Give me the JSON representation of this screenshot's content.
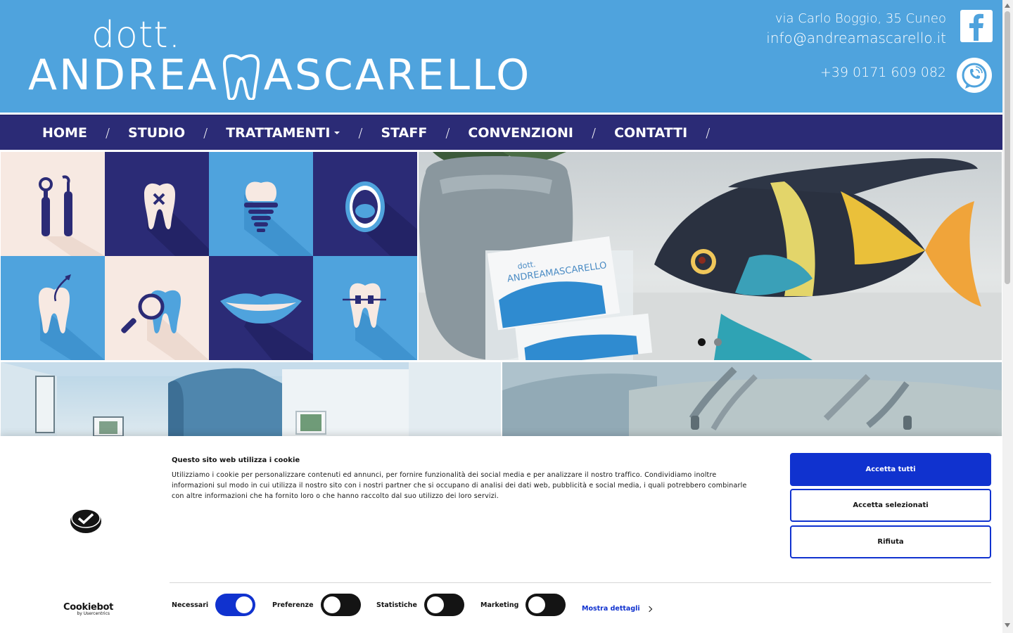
{
  "header": {
    "logo_dott": "dott.",
    "logo_name_left": "ANDREA",
    "logo_name_right": "ASCARELLO",
    "address": "via Carlo Boggio, 35 Cuneo",
    "email": "info@andreamascarello.it",
    "phone": "+39 0171 609 082",
    "facebook_icon": "facebook-icon",
    "phone_icon": "phone-icon"
  },
  "nav": {
    "items": [
      {
        "label": "HOME",
        "dropdown": false
      },
      {
        "label": "STUDIO",
        "dropdown": false
      },
      {
        "label": "TRATTAMENTI",
        "dropdown": true
      },
      {
        "label": "STAFF",
        "dropdown": false
      },
      {
        "label": "CONVENZIONI",
        "dropdown": false
      },
      {
        "label": "CONTATTI",
        "dropdown": false
      }
    ],
    "separator": "/"
  },
  "tiles": [
    {
      "icon": "dental-tools-icon",
      "bg": "#f7e9e2"
    },
    {
      "icon": "tooth-extraction-icon",
      "bg": "#2b2b76"
    },
    {
      "icon": "dental-implant-icon",
      "bg": "#4fa3dd"
    },
    {
      "icon": "open-mouth-icon",
      "bg": "#2b2b76"
    },
    {
      "icon": "root-canal-icon",
      "bg": "#4fa3dd"
    },
    {
      "icon": "tooth-magnifier-icon",
      "bg": "#f7e9e2"
    },
    {
      "icon": "lips-icon",
      "bg": "#2b2b76"
    },
    {
      "icon": "tooth-braces-icon",
      "bg": "#4fa3dd"
    }
  ],
  "slider": {
    "card_text_dott": "dott.",
    "card_text_name": "ANDREAMASCARELLO",
    "active_slide": 1,
    "slide_count": 2
  },
  "cookie": {
    "title": "Questo sito web utilizza i cookie",
    "text": "Utilizziamo i cookie per personalizzare contenuti ed annunci, per fornire funzionalità dei social media e per analizzare il nostro traffico. Condividiamo inoltre informazioni sul modo in cui utilizza il nostro sito con i nostri partner che si occupano di analisi dei dati web, pubblicità e social media, i quali potrebbero combinarle con altre informazioni che ha fornito loro o che hanno raccolto dal suo utilizzo dei loro servizi.",
    "accept_all": "Accetta tutti",
    "accept_selected": "Accetta selezionati",
    "reject": "Rifiuta",
    "brand": "Cookiebot",
    "brand_by": "by Usercentrics",
    "toggles": [
      {
        "label": "Necessari",
        "on": true
      },
      {
        "label": "Preferenze",
        "on": false
      },
      {
        "label": "Statistiche",
        "on": false
      },
      {
        "label": "Marketing",
        "on": false
      }
    ],
    "details_link": "Mostra dettagli",
    "colors": {
      "accent": "#1032cf",
      "dark": "#141414"
    }
  },
  "colors": {
    "header_bg": "#4fa3dd",
    "nav_bg": "#2b2b76",
    "tile_cream": "#f7e9e2"
  }
}
